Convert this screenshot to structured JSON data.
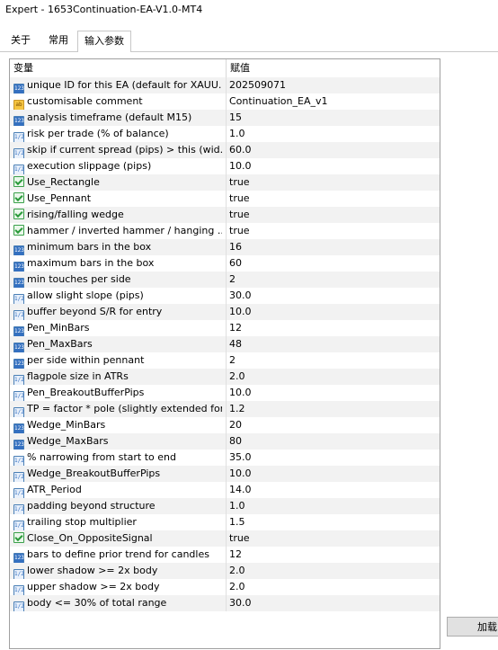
{
  "window": {
    "title": "Expert - 1653Continuation-EA-V1.0-MT4"
  },
  "tabs": [
    {
      "label": "关于"
    },
    {
      "label": "常用"
    },
    {
      "label": "输入参数",
      "active": true
    }
  ],
  "grid": {
    "col_variable": "变量",
    "col_value": "赋值",
    "rows": [
      {
        "type": "int",
        "icon": "integer-icon",
        "name": "unique ID for this EA (default for XAUU...",
        "value": "202509071"
      },
      {
        "type": "str",
        "icon": "string-icon",
        "name": "customisable comment",
        "value": "Continuation_EA_v1"
      },
      {
        "type": "int",
        "icon": "integer-icon",
        "name": "analysis timeframe (default M15)",
        "value": "15"
      },
      {
        "type": "dbl",
        "icon": "double-icon",
        "name": "risk per trade (% of balance)",
        "value": "1.0"
      },
      {
        "type": "dbl",
        "icon": "double-icon",
        "name": "skip if current spread (pips) > this (wid...",
        "value": "60.0"
      },
      {
        "type": "dbl",
        "icon": "double-icon",
        "name": "execution slippage (pips)",
        "value": "10.0"
      },
      {
        "type": "bool",
        "icon": "boolean-icon",
        "name": "Use_Rectangle",
        "value": "true"
      },
      {
        "type": "bool",
        "icon": "boolean-icon",
        "name": "Use_Pennant",
        "value": "true"
      },
      {
        "type": "bool",
        "icon": "boolean-icon",
        "name": "rising/falling wedge",
        "value": "true"
      },
      {
        "type": "bool",
        "icon": "boolean-icon",
        "name": "hammer / inverted hammer / hanging ...",
        "value": "true"
      },
      {
        "type": "int",
        "icon": "integer-icon",
        "name": "minimum bars in the box",
        "value": "16"
      },
      {
        "type": "int",
        "icon": "integer-icon",
        "name": "maximum bars in the box",
        "value": "60"
      },
      {
        "type": "int",
        "icon": "integer-icon",
        "name": "min touches per side",
        "value": "2"
      },
      {
        "type": "dbl",
        "icon": "double-icon",
        "name": "allow slight slope (pips)",
        "value": "30.0"
      },
      {
        "type": "dbl",
        "icon": "double-icon",
        "name": "buffer beyond S/R for entry",
        "value": "10.0"
      },
      {
        "type": "int",
        "icon": "integer-icon",
        "name": "Pen_MinBars",
        "value": "12"
      },
      {
        "type": "int",
        "icon": "integer-icon",
        "name": "Pen_MaxBars",
        "value": "48"
      },
      {
        "type": "int",
        "icon": "integer-icon",
        "name": "per side within pennant",
        "value": "2"
      },
      {
        "type": "dbl",
        "icon": "double-icon",
        "name": "flagpole size in ATRs",
        "value": "2.0"
      },
      {
        "type": "dbl",
        "icon": "double-icon",
        "name": "Pen_BreakoutBufferPips",
        "value": "10.0"
      },
      {
        "type": "dbl",
        "icon": "double-icon",
        "name": "TP = factor * pole (slightly extended for...",
        "value": "1.2"
      },
      {
        "type": "int",
        "icon": "integer-icon",
        "name": "Wedge_MinBars",
        "value": "20"
      },
      {
        "type": "int",
        "icon": "integer-icon",
        "name": "Wedge_MaxBars",
        "value": "80"
      },
      {
        "type": "dbl",
        "icon": "double-icon",
        "name": "% narrowing from start to end",
        "value": "35.0"
      },
      {
        "type": "dbl",
        "icon": "double-icon",
        "name": "Wedge_BreakoutBufferPips",
        "value": "10.0"
      },
      {
        "type": "dbl",
        "icon": "double-icon",
        "name": "ATR_Period",
        "value": "14.0"
      },
      {
        "type": "dbl",
        "icon": "double-icon",
        "name": "padding beyond structure",
        "value": "1.0"
      },
      {
        "type": "dbl",
        "icon": "double-icon",
        "name": "trailing stop multiplier",
        "value": "1.5"
      },
      {
        "type": "bool",
        "icon": "boolean-icon",
        "name": "Close_On_OppositeSignal",
        "value": "true"
      },
      {
        "type": "int",
        "icon": "integer-icon",
        "name": "bars to define prior trend for candles",
        "value": "12"
      },
      {
        "type": "dbl",
        "icon": "double-icon",
        "name": "lower shadow >= 2x body",
        "value": "2.0"
      },
      {
        "type": "dbl",
        "icon": "double-icon",
        "name": "upper shadow >= 2x body",
        "value": "2.0"
      },
      {
        "type": "dbl",
        "icon": "double-icon",
        "name": "body <= 30% of total range",
        "value": "30.0"
      }
    ]
  },
  "buttons": {
    "load_label": "加载"
  }
}
